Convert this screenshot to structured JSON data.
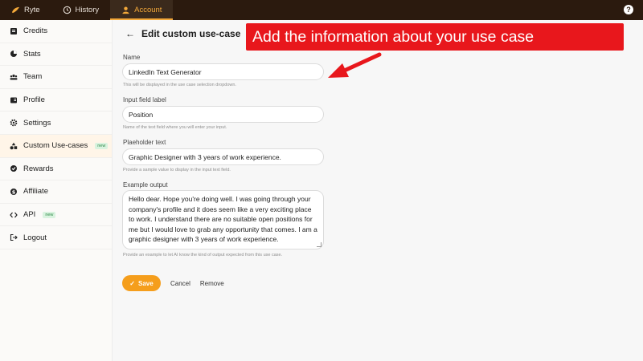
{
  "topbar": {
    "tabs": [
      {
        "label": "Ryte",
        "icon": "quill-logo-icon"
      },
      {
        "label": "History",
        "icon": "clock-icon"
      },
      {
        "label": "Account",
        "icon": "user-icon",
        "active": true
      }
    ],
    "help_icon": "help-icon",
    "help_symbol": "?"
  },
  "sidebar": {
    "items": [
      {
        "label": "Credits",
        "icon": "credits-icon"
      },
      {
        "label": "Stats",
        "icon": "pie-chart-icon"
      },
      {
        "label": "Team",
        "icon": "team-icon"
      },
      {
        "label": "Profile",
        "icon": "profile-icon"
      },
      {
        "label": "Settings",
        "icon": "gear-icon"
      },
      {
        "label": "Custom Use-cases",
        "icon": "shapes-icon",
        "badge": "new",
        "active": true
      },
      {
        "label": "Rewards",
        "icon": "rewards-icon"
      },
      {
        "label": "Affiliate",
        "icon": "dollar-icon"
      },
      {
        "label": "API",
        "icon": "code-icon",
        "badge": "new"
      },
      {
        "label": "Logout",
        "icon": "logout-icon"
      }
    ]
  },
  "main": {
    "back_symbol": "←",
    "title": "Edit custom use-case",
    "fields": {
      "name": {
        "label": "Name",
        "value": "LinkedIn Text Generator",
        "hint": "This will be displayed in the use case selection dropdown."
      },
      "input_label": {
        "label": "Input field label",
        "value": "Position",
        "hint": "Name of the text field where you will enter your input."
      },
      "placeholder": {
        "label": "Plaeholder text",
        "value": "Graphic Designer with 3 years of work experience.",
        "hint": "Provide a sample value to display in the input text field."
      },
      "example_output": {
        "label": "Example output",
        "value": "Hello dear. Hope you're doing well. I was going through your company's profile and it does seem like a very exciting place to work. I understand there are no suitable open positions for me but I would love to grab any opportunity that comes. I am a graphic designer with 3 years of work experience.",
        "hint": "Provide an example to let AI know the kind of output expected from this use case."
      }
    },
    "actions": {
      "save": "Save",
      "save_check": "✓",
      "cancel": "Cancel",
      "remove": "Remove"
    }
  },
  "annotation": {
    "text": "Add the information about your use case",
    "color": "#e8171c"
  },
  "colors": {
    "accent": "#f59e1c",
    "topbar": "#2b1a0e"
  }
}
